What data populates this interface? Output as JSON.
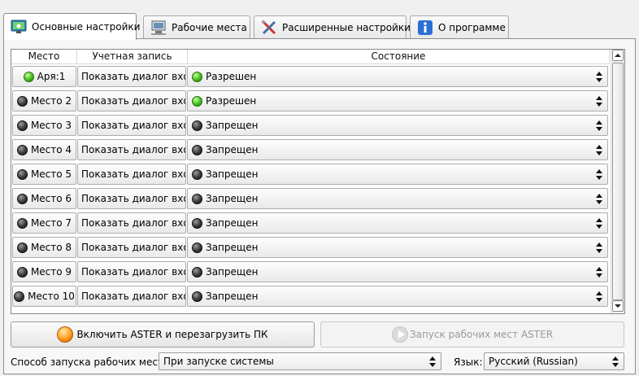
{
  "tabs": [
    {
      "label": "Основные настройки",
      "icon": "settings-monitor-icon"
    },
    {
      "label": "Рабочие места",
      "icon": "workstations-icon"
    },
    {
      "label": "Расширенные настройки",
      "icon": "tools-icon"
    },
    {
      "label": "О программе",
      "icon": "info-icon"
    }
  ],
  "table": {
    "headers": [
      "Место",
      "Учетная запись",
      "Состояние"
    ],
    "rows": [
      {
        "place": "Аря:1",
        "account": "Показать диалог входа",
        "state": "Разрешен",
        "status_color": "green"
      },
      {
        "place": "Место 2",
        "account": "Показать диалог входа",
        "state": "Разрешен",
        "status_color": "dark"
      },
      {
        "place": "Место 3",
        "account": "Показать диалог входа",
        "state": "Запрещен",
        "status_color": "dark"
      },
      {
        "place": "Место 4",
        "account": "Показать диалог входа",
        "state": "Запрещен",
        "status_color": "dark"
      },
      {
        "place": "Место 5",
        "account": "Показать диалог входа",
        "state": "Запрещен",
        "status_color": "dark"
      },
      {
        "place": "Место 6",
        "account": "Показать диалог входа",
        "state": "Запрещен",
        "status_color": "dark"
      },
      {
        "place": "Место 7",
        "account": "Показать диалог входа",
        "state": "Запрещен",
        "status_color": "dark"
      },
      {
        "place": "Место 8",
        "account": "Показать диалог входа",
        "state": "Запрещен",
        "status_color": "dark"
      },
      {
        "place": "Место 9",
        "account": "Показать диалог входа",
        "state": "Запрещен",
        "status_color": "dark"
      },
      {
        "place": "Место 10",
        "account": "Показать диалог входа",
        "state": "Запрещен",
        "status_color": "dark"
      }
    ]
  },
  "buttons": {
    "enable_label": "Включить ASTER и перезагрузить ПК",
    "launch_label": "Запуск рабочих мест ASTER"
  },
  "launch_mode": {
    "label": "Способ запуска рабочих мест:",
    "value": "При запуске системы"
  },
  "language": {
    "label": "Язык:",
    "value": "Русский (Russian)"
  },
  "colors": {
    "green": "#3fbf1f",
    "dark": "#3a3a3a",
    "accent": "#ff9c1a"
  }
}
